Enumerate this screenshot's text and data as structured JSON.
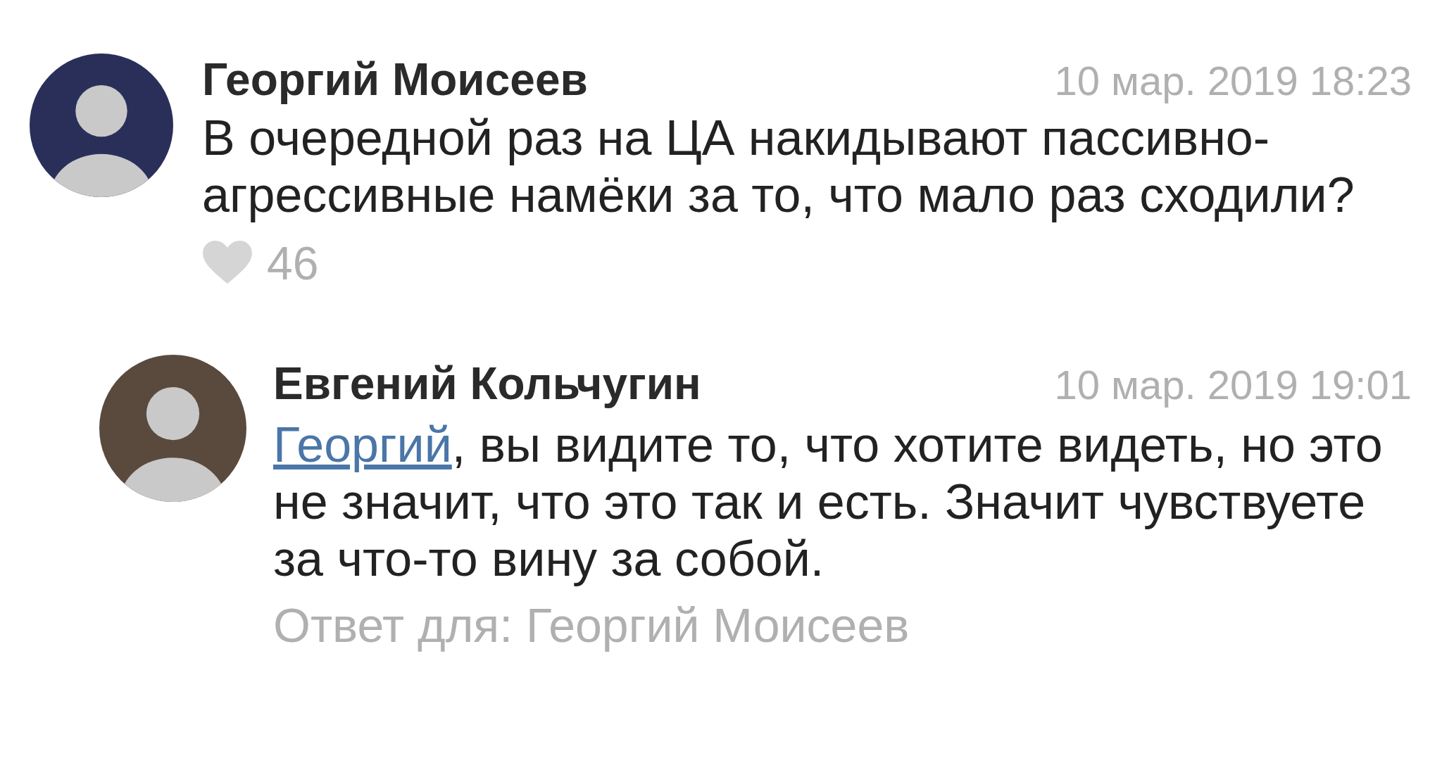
{
  "comments": [
    {
      "author": "Георгий Моисеев",
      "date": "10 мар. 2019 18:23",
      "text": "В очередной раз на ЦА накидывают пассивно-агрессивные намёки за то, что мало раз сходили?",
      "likes": "46",
      "children": [
        {
          "author": "Евгений Кольчугин",
          "date": "10 мар. 2019 19:01",
          "mention": "Георгий",
          "text": ", вы видите то, что хотите видеть, но это не значит, что это так и есть. Значит чувствуете за что-то вину за собой.",
          "reply_to": "Ответ для: Георгий Моисеев"
        }
      ]
    }
  ]
}
